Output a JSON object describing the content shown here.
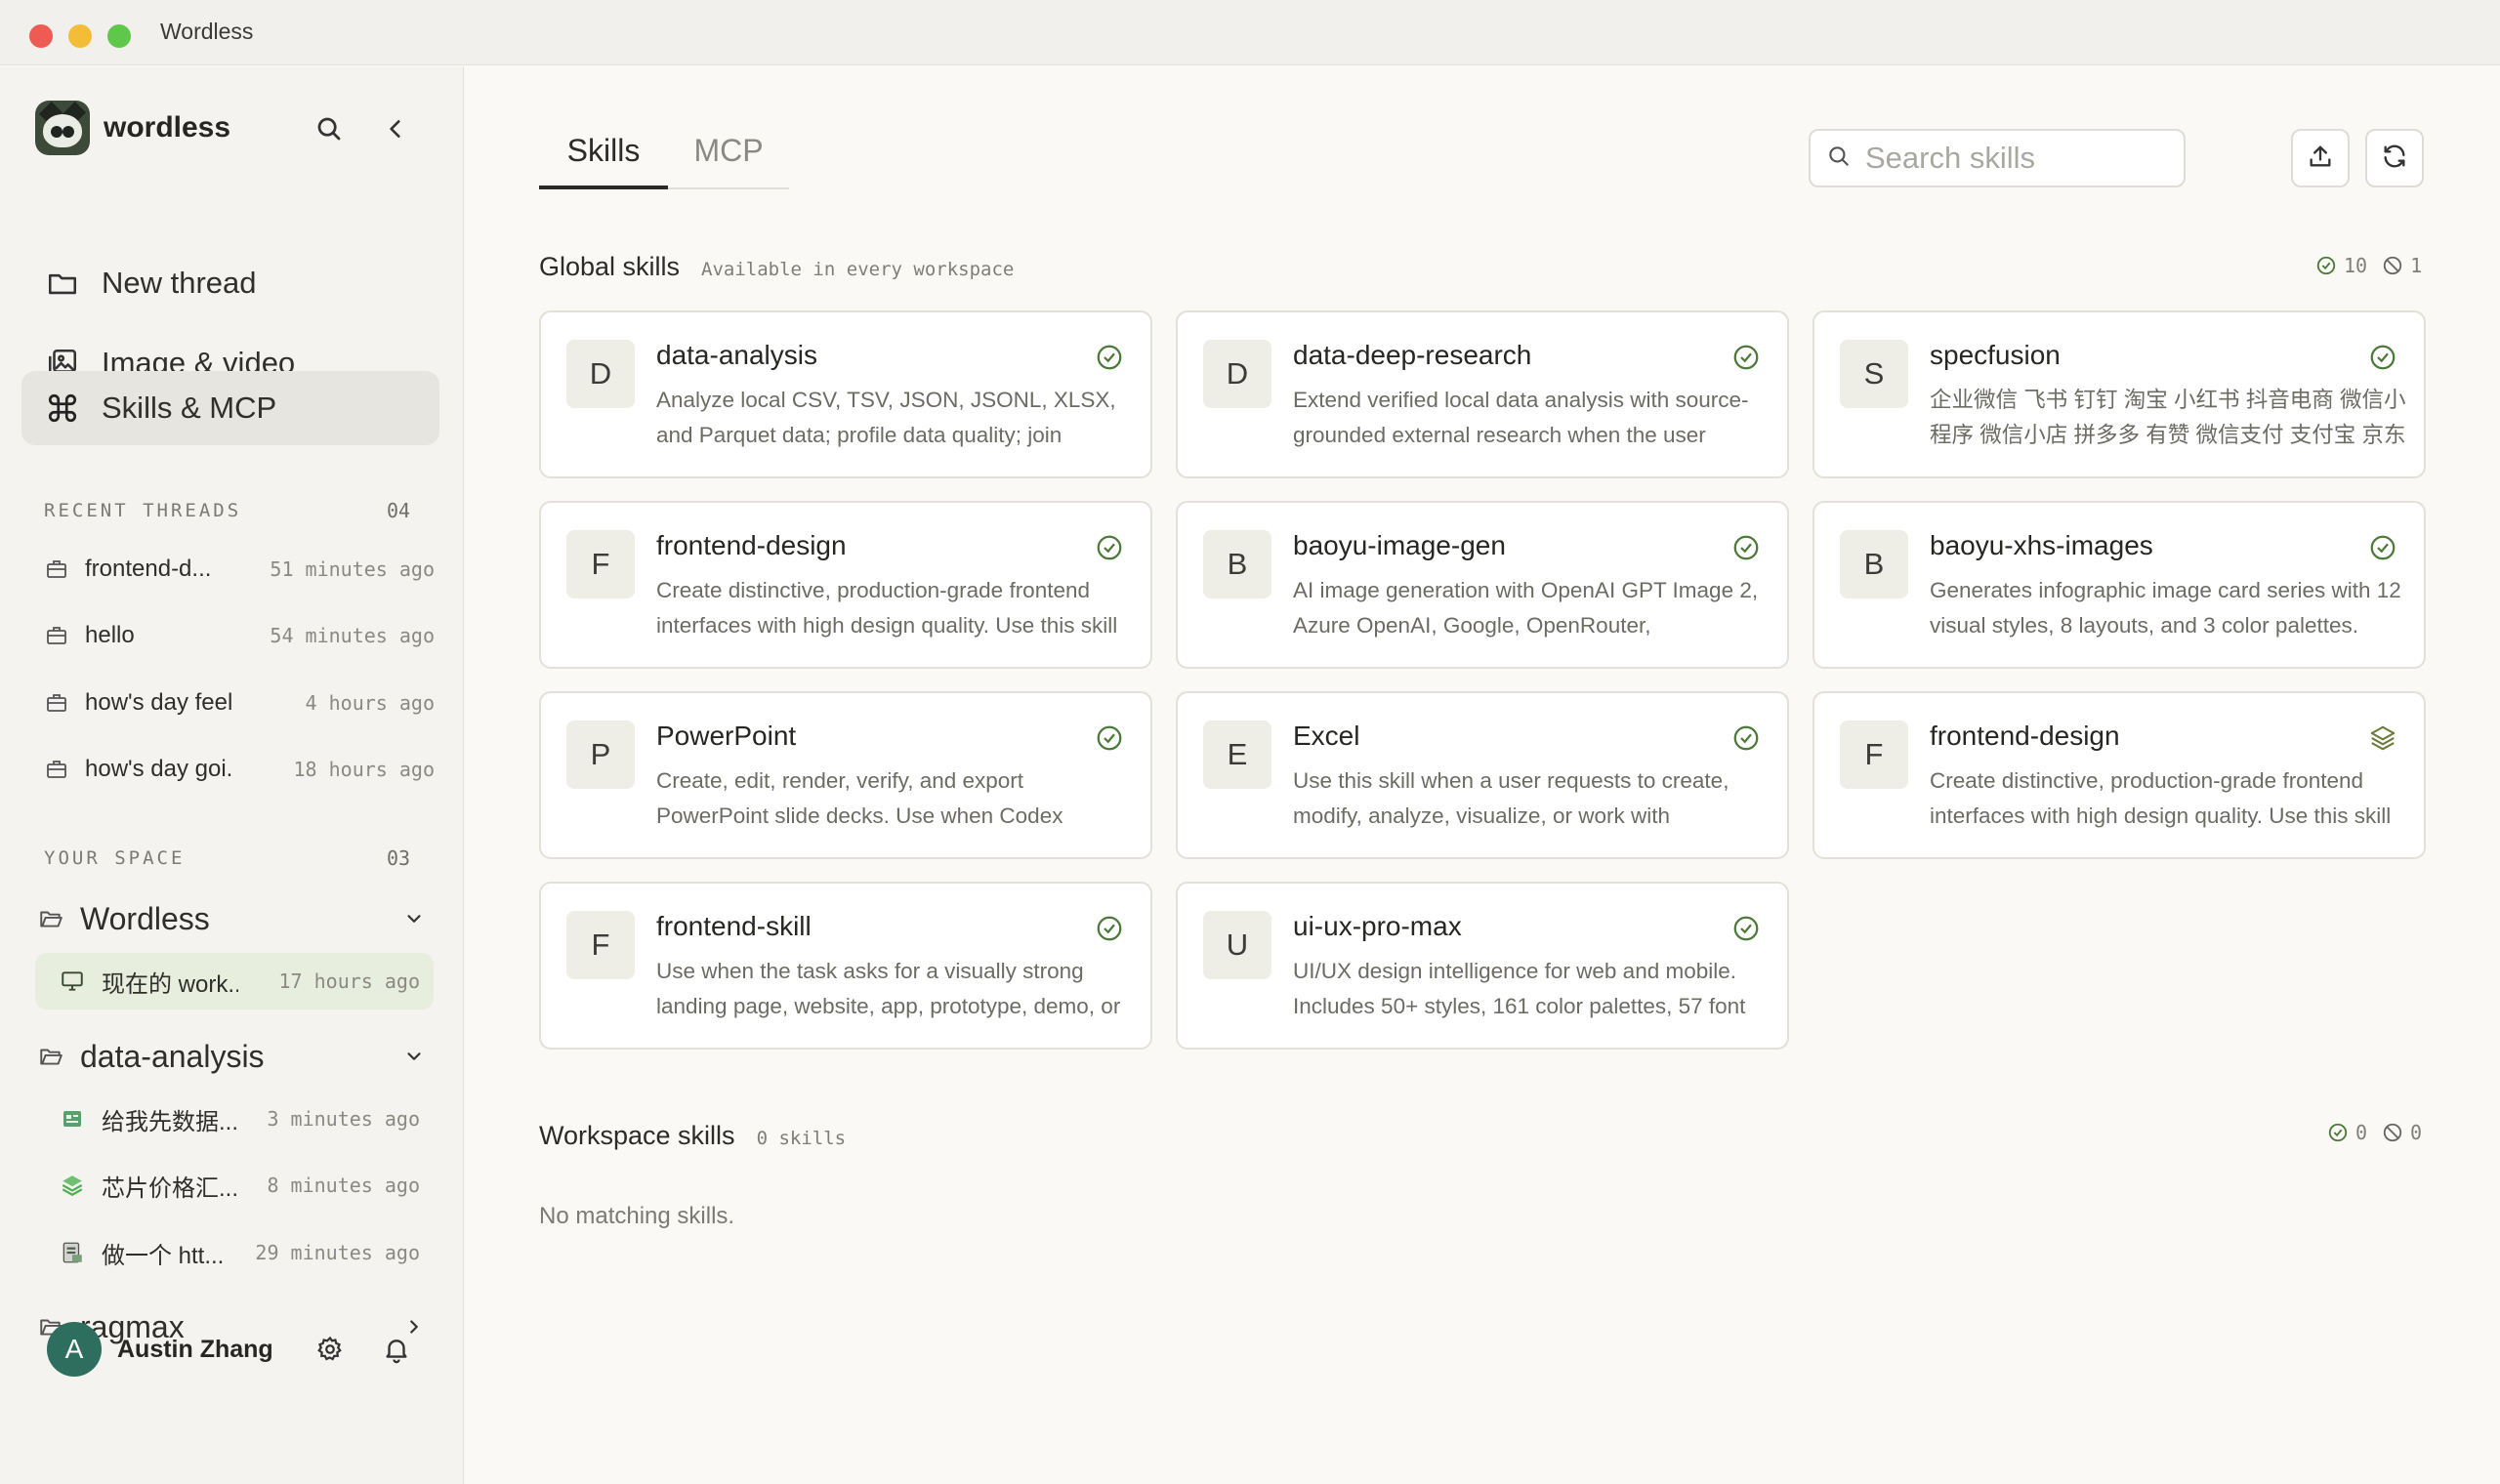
{
  "window": {
    "title": "Wordless"
  },
  "sidebar": {
    "brand": "wordless",
    "nav": [
      {
        "label": "New thread",
        "icon": "folder-icon"
      },
      {
        "label": "Image & video",
        "icon": "image-icon"
      },
      {
        "label": "Skills & MCP",
        "icon": "command-icon",
        "active": true
      }
    ],
    "recent": {
      "label": "RECENT THREADS",
      "count": "04",
      "items": [
        {
          "title": "frontend-d...",
          "time": "51 minutes ago"
        },
        {
          "title": "hello",
          "time": "54 minutes ago"
        },
        {
          "title": "how's day feeli...",
          "time": "4 hours ago"
        },
        {
          "title": "how's day goi...",
          "time": "18 hours ago"
        }
      ]
    },
    "space": {
      "label": "YOUR SPACE",
      "count": "03",
      "workspaces": [
        {
          "name": "Wordless",
          "threads": [
            {
              "title": "现在的 work...",
              "time": "17 hours ago"
            }
          ]
        },
        {
          "name": "data-analysis",
          "threads": [
            {
              "title": "给我先数据...",
              "time": "3 minutes ago"
            },
            {
              "title": "芯片价格汇...",
              "time": "8 minutes ago"
            },
            {
              "title": "做一个 htt...",
              "time": "29 minutes ago"
            }
          ]
        },
        {
          "name": "ragmax",
          "threads": []
        }
      ]
    },
    "user": {
      "initial": "A",
      "name": "Austin Zhang"
    }
  },
  "main": {
    "tabs": [
      {
        "label": "Skills"
      },
      {
        "label": "MCP"
      }
    ],
    "search": {
      "placeholder": "Search skills",
      "value": ""
    },
    "global": {
      "title": "Global skills",
      "subtitle": "Available in every workspace",
      "enabled_count": "10",
      "disabled_count": "1",
      "skills": [
        {
          "letter": "D",
          "name": "data-analysis",
          "desc": "Analyze local CSV, TSV, JSON, JSONL, XLSX, and Parquet data; profile data quality; join multiple",
          "status": "check-circle-icon"
        },
        {
          "letter": "D",
          "name": "data-deep-research",
          "desc": "Extend verified local data analysis with source-grounded external research when the user",
          "status": "check-circle-icon"
        },
        {
          "letter": "S",
          "name": "specfusion",
          "desc": "企业微信 飞书 钉钉 淘宝 小红书 抖音电商 微信小程序 微信小店 拼多多 有赞 微信支付 支付宝 京东",
          "status": "check-circle-icon"
        },
        {
          "letter": "F",
          "name": "frontend-design",
          "desc": "Create distinctive, production-grade frontend interfaces with high design quality. Use this skill",
          "status": "check-circle-icon"
        },
        {
          "letter": "B",
          "name": "baoyu-image-gen",
          "desc": "AI image generation with OpenAI GPT Image 2, Azure OpenAI, Google, OpenRouter,",
          "status": "check-circle-icon"
        },
        {
          "letter": "B",
          "name": "baoyu-xhs-images",
          "desc": "Generates infographic image card series with 12 visual styles, 8 layouts, and 3 color palettes.",
          "status": "check-circle-icon"
        },
        {
          "letter": "P",
          "name": "PowerPoint",
          "desc": "Create, edit, render, verify, and export PowerPoint slide decks. Use when Codex",
          "status": "check-circle-icon"
        },
        {
          "letter": "E",
          "name": "Excel",
          "desc": "Use this skill when a user requests to create, modify, analyze, visualize, or work with",
          "status": "check-circle-icon"
        },
        {
          "letter": "F",
          "name": "frontend-design",
          "desc": "Create distinctive, production-grade frontend interfaces with high design quality. Use this skill",
          "status": "layers-icon"
        },
        {
          "letter": "F",
          "name": "frontend-skill",
          "desc": "Use when the task asks for a visually strong landing page, website, app, prototype, demo, or",
          "status": "check-circle-icon"
        },
        {
          "letter": "U",
          "name": "ui-ux-pro-max",
          "desc": "UI/UX design intelligence for web and mobile. Includes 50+ styles, 161 color palettes, 57 font",
          "status": "check-circle-icon"
        }
      ]
    },
    "workspace": {
      "title": "Workspace skills",
      "subtitle": "0 skills",
      "enabled_count": "0",
      "disabled_count": "0",
      "empty": "No matching skills."
    }
  },
  "colors": {
    "accent_green": "#4d7a3a",
    "active_bg": "#e6e5e0",
    "avatar": "#2d6e5e"
  }
}
